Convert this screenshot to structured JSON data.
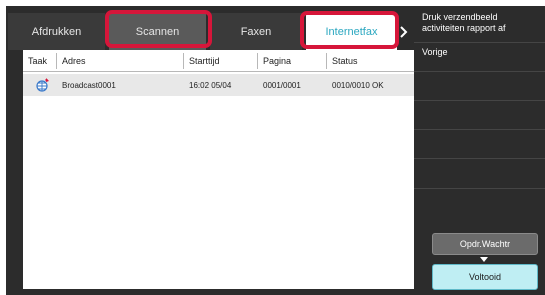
{
  "tabs": [
    {
      "label": "Afdrukken",
      "active": false
    },
    {
      "label": "Scannen",
      "active": false
    },
    {
      "label": "Faxen",
      "active": false
    },
    {
      "label": "Internetfax",
      "active": true
    }
  ],
  "table": {
    "headers": [
      "Taak",
      "Adres",
      "Starttijd",
      "Pagina",
      "Status"
    ],
    "rows": [
      {
        "icon": "broadcast-icon",
        "adres": "Broadcast0001",
        "starttijd": "16:02 05/04",
        "pagina": "0001/0001",
        "status": "0010/0010 OK"
      }
    ]
  },
  "sidebar": {
    "items": [
      {
        "label": "Druk verzendbeeld activiteiten rapport af"
      },
      {
        "label": "Vorige"
      }
    ]
  },
  "buttons": {
    "queue": "Opdr.Wachtr",
    "done": "Voltooid"
  },
  "colors": {
    "highlight": "#d6163a",
    "active_tab_text": "#2aa7c0",
    "done_button": "#bfeef3"
  }
}
